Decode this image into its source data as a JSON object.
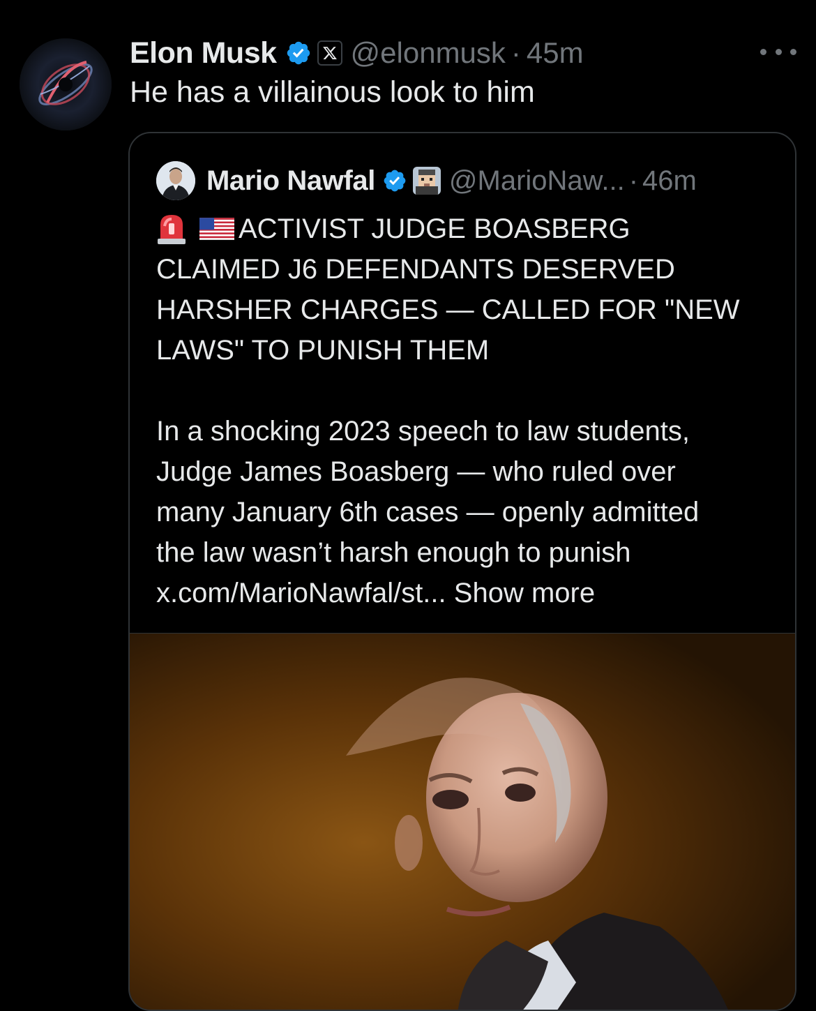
{
  "tweet": {
    "author": {
      "display_name": "Elon Musk",
      "handle": "@elonmusk",
      "avatar_icon": "galaxy-avatar",
      "verified_icon": "verified-badge-icon",
      "affiliate_icon": "x-logo-icon"
    },
    "separator": "·",
    "time": "45m",
    "text": "He has a villainous look to him",
    "more_icon": "more-dots-icon"
  },
  "quoted": {
    "author": {
      "display_name": "Mario Nawfal",
      "handle": "@MarioNaw...",
      "avatar_icon": "person-avatar",
      "verified_icon": "verified-badge-icon",
      "affiliate_icon": "pixel-avatar-icon"
    },
    "separator": "·",
    "time": "46m",
    "headline_emojis": [
      "siren-emoji",
      "us-flag-emoji"
    ],
    "headline_lines": [
      "ACTIVIST JUDGE BOASBERG",
      "CLAIMED J6 DEFENDANTS DESERVED",
      "HARSHER CHARGES — CALLED FOR \"NEW",
      "LAWS\" TO PUNISH THEM"
    ],
    "body_lines": [
      "In a shocking 2023 speech to law students,",
      "Judge James Boasberg — who ruled over",
      "many January 6th cases — openly admitted",
      "the law wasn’t harsh enough to punish"
    ],
    "link_text": "x.com/MarioNawfal/st...",
    "show_more": "Show more",
    "media": "photo of a bald man in a suit"
  },
  "colors": {
    "background": "#000000",
    "primary_text": "#e7e9ea",
    "secondary_text": "#71767b",
    "border": "#2f3336",
    "verified_blue": "#1d9bf0"
  }
}
